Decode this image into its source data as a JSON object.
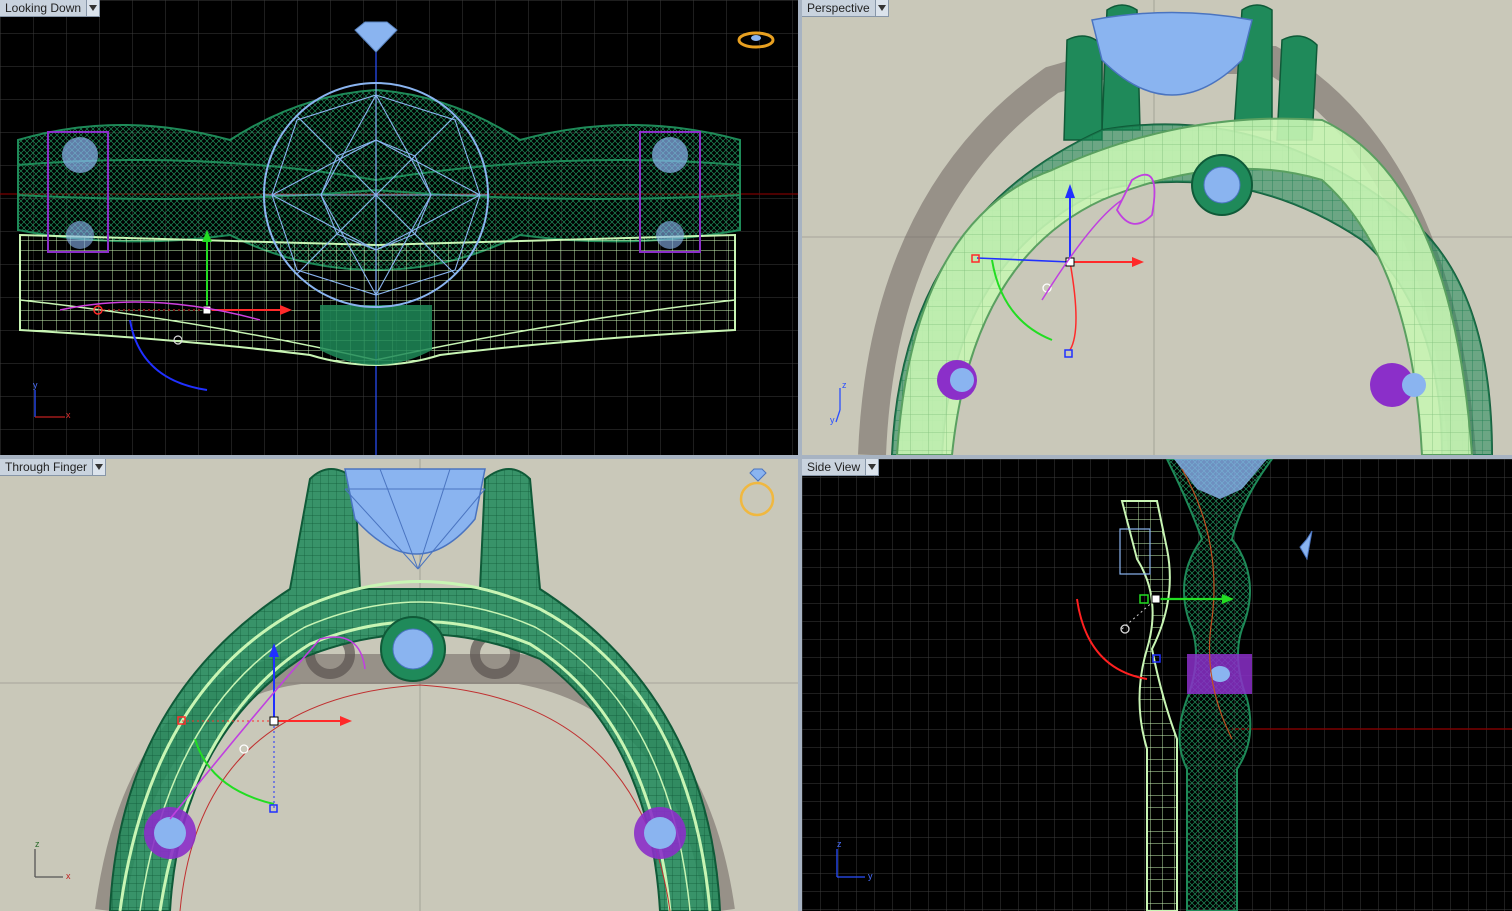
{
  "viewports": {
    "top_left": {
      "title": "Looking Down",
      "axis_v": "y",
      "axis_h": "x"
    },
    "top_right": {
      "title": "Perspective",
      "axis_v": "z",
      "axis_h": "y"
    },
    "bottom_left": {
      "title": "Through Finger",
      "axis_v": "z",
      "axis_h": "x"
    },
    "bottom_right": {
      "title": "Side View",
      "axis_v": "z",
      "axis_h": "y"
    }
  },
  "colors": {
    "viewport_dark_bg": "#000000",
    "viewport_photo_bg": "#c8c7b8",
    "grid_dark": "#3a3a3a",
    "wire_green": "#1e8a58",
    "band_lightgreen": "#c8f5b4",
    "stone_blue": "#8ab4f0",
    "accent_purple": "#8b2fc9",
    "gizmo_red": "#ff2a2a",
    "gizmo_green": "#22dd22",
    "gizmo_blue": "#2030ff"
  },
  "icons": [
    "dropdown-icon",
    "diamond-icon",
    "ring-icon",
    "axis-icon",
    "gizmo-icon"
  ]
}
